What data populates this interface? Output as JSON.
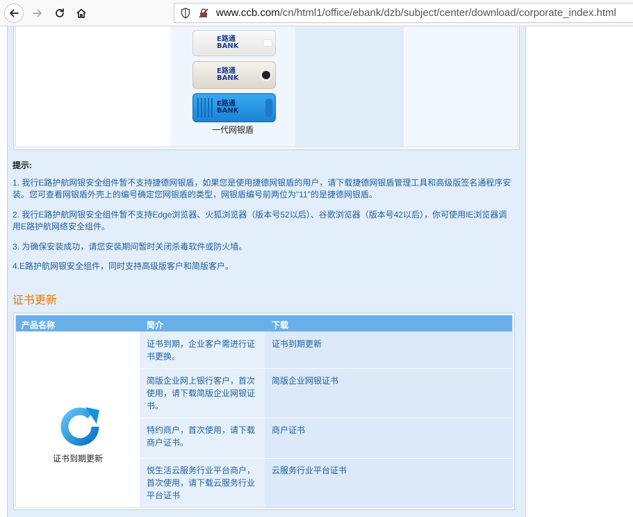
{
  "browser": {
    "url_domain": "www.ccb.com",
    "url_path": "/cn/html1/office/ebank/dzb/subject/center/download/corporate_index.html"
  },
  "usb_keys": {
    "logo_text": "E路通",
    "logo_sub": "BANK",
    "caption": "一代网银盾"
  },
  "tips": {
    "title": "提示:",
    "items": [
      "1. 我行E路护航网银安全组件暂不支持捷德网银盾，如果您是使用捷德网银盾的用户，请下载捷德网银盾管理工具和高级版签名通程序安装。您可查看网银盾外壳上的编号确定您网银盾的类型，网银盾编号前两位为\"11\"的是捷德网银盾。",
      "2. 我行E路护航网银安全组件暂不支持Edge浏览器、火狐浏览器（版本号52以后）、谷歌浏览器（版本号42以后），你可使用IE浏览器调用E路护航网络安全组件。",
      "3. 为确保安装成功，请您安装期间暂时关闭杀毒软件或防火墙。",
      "4.E路护航网银安全组件，同时支持高级版客户和简版客户。"
    ]
  },
  "cert_section": {
    "heading": "证书更新",
    "headers": [
      "产品名称",
      "简介",
      "下载"
    ],
    "product_label": "证书到期更新",
    "rows": [
      {
        "desc": "证书到期，企业客户需进行证书更换。",
        "download": "证书到期更新"
      },
      {
        "desc": "简版企业网上银行客户，首次使用，请下载简版企业网银证书。",
        "download": "简版企业网银证书"
      },
      {
        "desc": "特约商户，首次使用，请下载商户证书。",
        "download": "商户证书"
      },
      {
        "desc": "悦生活云服务行业平台商户，首次使用，请下载云服务行业平台证书",
        "download": "云服务行业平台证书"
      }
    ]
  },
  "colors": {
    "accent_orange": "#e57a00",
    "link_blue": "#1f5f9b",
    "table_header": "#6ab0e8"
  }
}
